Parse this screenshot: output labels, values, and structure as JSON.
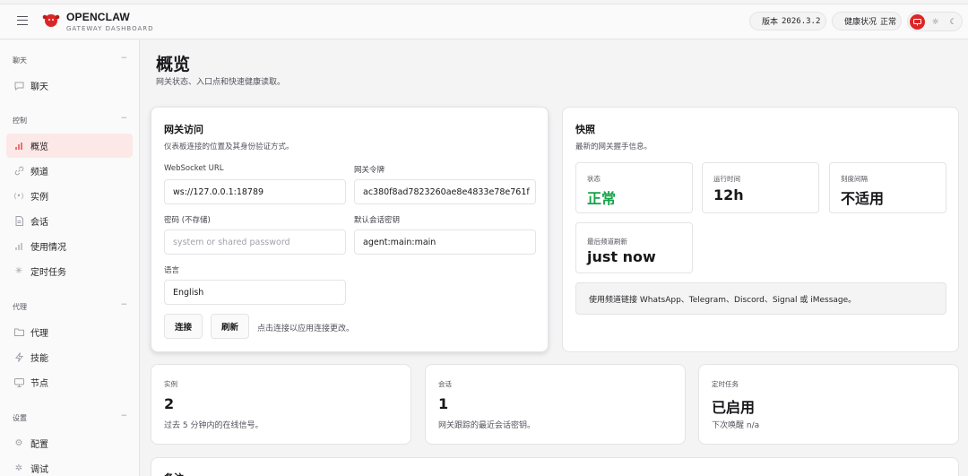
{
  "brand": {
    "title": "OPENCLAW",
    "subtitle": "GATEWAY DASHBOARD"
  },
  "header": {
    "version_label": "版本",
    "version_value": "2026.3.2",
    "health_label": "健康状况",
    "health_value": "正常",
    "status_color": "#16a34a",
    "theme_icons": [
      "monitor-icon",
      "sun-icon",
      "moon-icon"
    ]
  },
  "sidebar": {
    "groups": {
      "chat": "聊天",
      "control": "控制",
      "agent": "代理",
      "settings": "设置"
    },
    "collapse_glyph": "−",
    "items": {
      "chat": "聊天",
      "overview": "概览",
      "channels": "频道",
      "instances": "实例",
      "sessions": "会话",
      "usage": "使用情况",
      "cron": "定时任务",
      "agents": "代理",
      "skills": "技能",
      "nodes": "节点",
      "config": "配置",
      "debug": "调试"
    }
  },
  "page": {
    "title": "概览",
    "subtitle": "网关状态、入口点和快速健康读取。"
  },
  "gateway": {
    "title": "网关访问",
    "desc": "仪表板连接的位置及其身份验证方式。",
    "ws_label": "WebSocket URL",
    "ws_value": "ws://127.0.0.1:18789",
    "token_label": "网关令牌",
    "token_value": "ac380f8ad7823260ae8e4833e78e761f",
    "password_label": "密码 (不存储)",
    "password_placeholder": "system or shared password",
    "session_label": "默认会话密钥",
    "session_value": "agent:main:main",
    "lang_label": "语言",
    "lang_value": "English",
    "connect": "连接",
    "refresh": "刷新",
    "hint": "点击连接以应用连接更改。"
  },
  "snapshot": {
    "title": "快照",
    "desc": "最新的网关握手信息。",
    "status_label": "状态",
    "status_value": "正常",
    "uptime_label": "运行时间",
    "uptime_value": "12h",
    "tick_label": "刻度间隔",
    "tick_value": "不适用",
    "refresh_label": "最后频道刷新",
    "refresh_value": "just now",
    "note": "使用频道链接 WhatsApp、Telegram、Discord、Signal 或 iMessage。"
  },
  "cards": {
    "instances_label": "实例",
    "instances_value": "2",
    "instances_sub": "过去 5 分钟内的在线信号。",
    "sessions_label": "会话",
    "sessions_value": "1",
    "sessions_sub": "网关跟踪的最近会话密钥。",
    "cron_label": "定时任务",
    "cron_value": "已启用",
    "cron_sub": "下次唤醒 n/a"
  },
  "notes": {
    "title": "备注"
  }
}
